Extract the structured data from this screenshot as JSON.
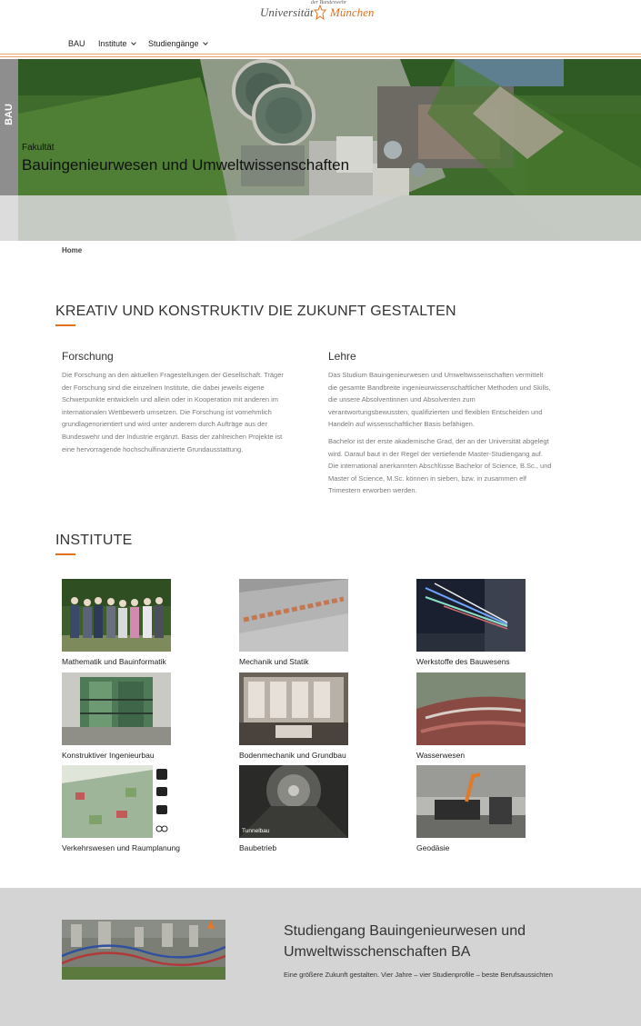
{
  "logo": {
    "small_text": "der Bundeswehr",
    "university": "Universität",
    "city": "München",
    "accent_color": "#e3701d"
  },
  "nav": {
    "items": [
      {
        "label": "BAU",
        "has_dropdown": false
      },
      {
        "label": "Institute",
        "has_dropdown": true
      },
      {
        "label": "Studiengänge",
        "has_dropdown": true
      }
    ]
  },
  "hero": {
    "side_tab": "BAU",
    "kicker": "Fakultät",
    "title": "Bauingenieurwesen und Umweltwissenschaften"
  },
  "breadcrumb": {
    "home": "Home"
  },
  "intro": {
    "heading": "KREATIV UND KONSTRUKTIV DIE ZUKUNFT GESTALTEN",
    "research": {
      "title": "Forschung",
      "lines": [
        "Die Forschung an den aktuellen Fragestellungen der Gesellschaft. Träger",
        "der Forschung sind die einzelnen Institute, die dabei jeweils eigene",
        "Schwerpunkte entwickeln und allein oder in Kooperation mit anderen im",
        "internationalen Wettbewerb umsetzen. Die Forschung ist vornehmlich",
        "grundlagenorientiert und wird unter anderem durch Aufträge aus der",
        "Bundeswehr und der Industrie ergänzt. Basis der zahlreichen Projekte ist",
        "eine hervorragende hochschulfinanzierte Grundausstattung."
      ]
    },
    "teaching": {
      "title": "Lehre",
      "paragraph1_lines": [
        "Das Studium Bauingenieurwesen und Umweltwissenschaften vermittelt",
        "die gesamte Bandbreite ingenieurwissenschaftlicher Methoden und Skills,",
        "die unsere Absolventinnen und Absolventen zum",
        "verantwortungsbewussten, qualifizierten und flexiblen Entscheiden und",
        "Handeln auf wissenschaftlicher Basis befähigen."
      ],
      "paragraph2_lines": [
        "Bachelor ist der erste akademische Grad, der an der Universität abgelegt",
        "wird. Darauf baut in der Regel der vertiefende Master-Studiengang auf.",
        "Die international anerkannten Abschlüsse Bachelor of Science, B.Sc., und",
        "Master of Science, M.Sc. können in sieben, bzw. in zusammen elf",
        "Trimestern erworben werden."
      ]
    }
  },
  "institutes": {
    "heading": "INSTITUTE",
    "items": [
      {
        "label": "Mathematik und Bauinformatik",
        "image": "group-photo"
      },
      {
        "label": "Mechanik und Statik",
        "image": "lettering-detail"
      },
      {
        "label": "Werkstoffe des Bauwesens",
        "image": "lab-laser"
      },
      {
        "label": "Konstruktiver Ingenieurbau",
        "image": "steel-test-rig"
      },
      {
        "label": "Bodenmechanik und Grundbau",
        "image": "soil-lab-equipment"
      },
      {
        "label": "Wasserwesen",
        "image": "weir-water"
      },
      {
        "label": "Verkehrswesen und Raumplanung",
        "image": "transport-map"
      },
      {
        "label": "Baubetrieb",
        "image": "tunnel",
        "caption": "Tunnelbau"
      },
      {
        "label": "Geodäsie",
        "image": "survey-lab"
      }
    ]
  },
  "study": {
    "title": "Studiengang Bauingenieurwesen und Umweltwisschenschaften BA",
    "text": "Eine größere Zukunft gestalten. Vier Jahre – vier Studienprofile – beste Berufsaussichten"
  }
}
